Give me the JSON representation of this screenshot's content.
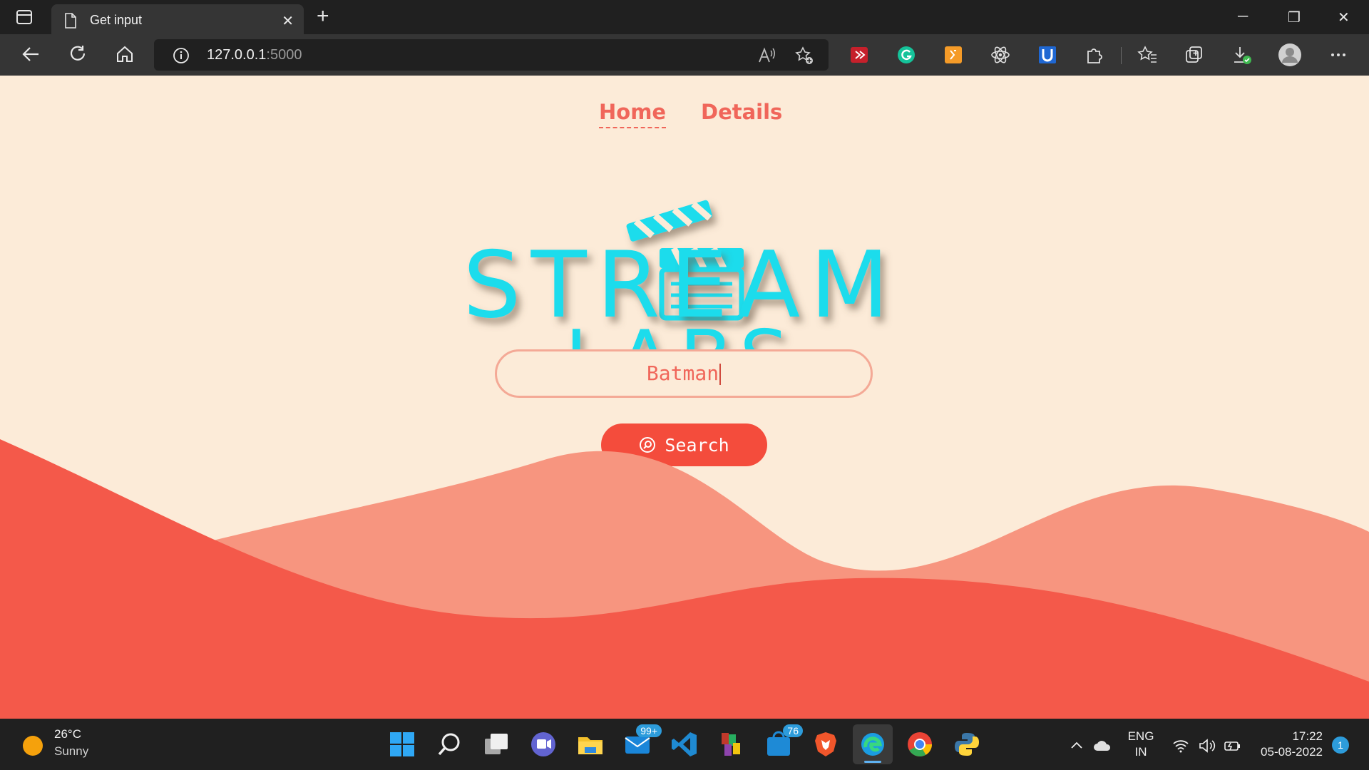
{
  "browser": {
    "tab_title": "Get input",
    "url_host": "127.0.0.1",
    "url_port": ":5000",
    "new_tab_symbol": "+",
    "close_tab_symbol": "✕",
    "minimize_symbol": "─",
    "restore_symbol": "❐",
    "close_window_symbol": "✕"
  },
  "page": {
    "nav": [
      {
        "label": "Home",
        "active": true
      },
      {
        "label": "Details",
        "active": false
      }
    ],
    "logo_line1": "STREAM",
    "logo_line2": "LABS",
    "search_value": "Batman",
    "search_button_label": "Search",
    "colors": {
      "background": "#fcebd8",
      "accent": "#f0665a",
      "button": "#f44c3c",
      "logo": "#1fdcec",
      "wave_light": "#f7957f",
      "wave_dark": "#f4594a"
    }
  },
  "taskbar": {
    "weather_temp": "26°C",
    "weather_condition": "Sunny",
    "mail_badge": "99+",
    "store_badge": "76",
    "lang_line1": "ENG",
    "lang_line2": "IN",
    "time": "17:22",
    "date": "05-08-2022",
    "notifications": "1"
  }
}
